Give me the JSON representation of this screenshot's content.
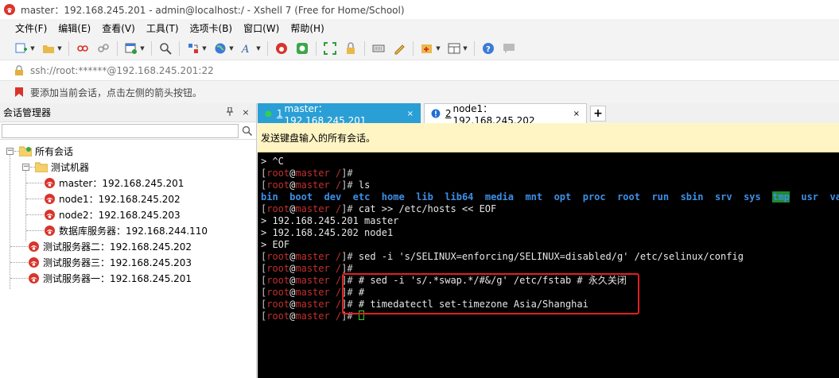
{
  "window": {
    "title": "master：192.168.245.201 - admin@localhost:/ - Xshell 7 (Free for Home/School)"
  },
  "menu": [
    "文件(F)",
    "编辑(E)",
    "查看(V)",
    "工具(T)",
    "选项卡(B)",
    "窗口(W)",
    "帮助(H)"
  ],
  "toolbar": {
    "icons": [
      "new-session-icon",
      "open-folder-icon",
      "connect-icon",
      "disconnect-icon",
      "properties-icon",
      "find-icon",
      "transfer-icon",
      "globe-icon",
      "font-icon",
      "xshell-icon",
      "xftp-icon",
      "fullscreen-icon",
      "lock-icon",
      "keyboard-icon",
      "script-icon",
      "add-icon",
      "layout-icon",
      "help-icon",
      "chat-icon"
    ]
  },
  "address": {
    "value": "ssh://root:******@192.168.245.201:22"
  },
  "hint": {
    "text": "要添加当前会话，点击左侧的箭头按钮。"
  },
  "session_manager": {
    "title": "会话管理器",
    "pin": "ꟸ",
    "close": "×",
    "search_value": "",
    "tree": {
      "root": "所有会话",
      "group": "测试机器",
      "group_sessions": [
        "master：192.168.245.201",
        "node1：192.168.245.202",
        "node2：192.168.245.203",
        "数据库服务器：192.168.244.110"
      ],
      "sessions": [
        "测试服务器二：192.168.245.202",
        "测试服务器三：192.168.245.203",
        "测试服务器一：192.168.245.201"
      ]
    }
  },
  "tabs": [
    {
      "num": "1",
      "label": "master：192.168.245.201",
      "status": "connected",
      "close": "×"
    },
    {
      "num": "2",
      "label": "node1：192.168.245.202",
      "status": "warning",
      "close": "×"
    }
  ],
  "tab_add": "+",
  "banner": {
    "text": "发送键盘输入的所有会话。"
  },
  "terminal": {
    "prompt": {
      "open": "[",
      "user": "root",
      "at": "@",
      "host": "master",
      "path": " /",
      "close": "]#"
    },
    "ctrl_c": "> ^C",
    "cmd_ls": " ls",
    "ls_dirs": [
      "bin",
      "boot",
      "dev",
      "etc",
      "home",
      "lib",
      "lib64",
      "media",
      "mnt",
      "opt",
      "proc",
      "root",
      "run",
      "sbin",
      "srv",
      "sys",
      "tmp",
      "usr",
      "var"
    ],
    "cmd_cat": " cat >> /etc/hosts << EOF",
    "heredoc": [
      "> 192.168.245.201 master",
      "> 192.168.245.202 node1",
      "> EOF"
    ],
    "cmd_selinux": " sed -i 's/SELINUX=enforcing/SELINUX=disabled/g' /etc/selinux/config",
    "hash": " #",
    "cmd_swap": " # sed -i 's/.*swap.*/#&/g' /etc/fstab # 永久关闭",
    "cmd_tz": " # timedatectl set-timezone Asia/Shanghai"
  }
}
